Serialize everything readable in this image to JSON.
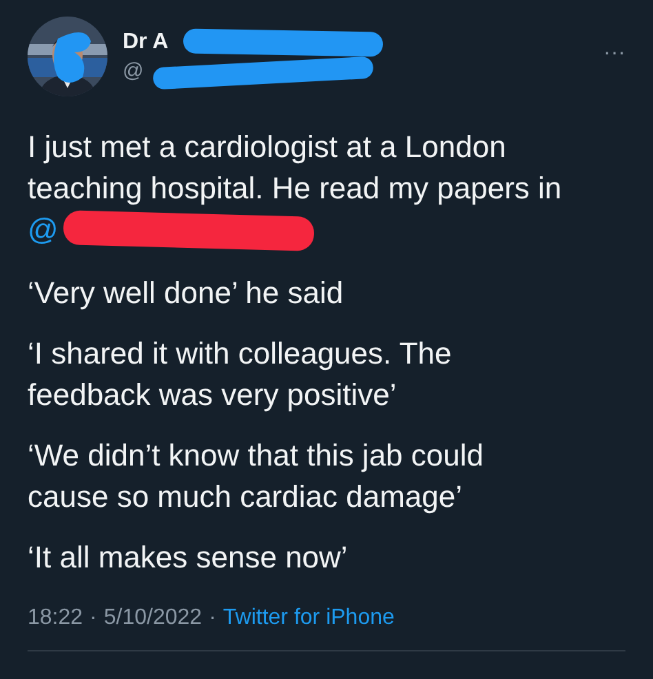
{
  "author": {
    "name": "Dr A",
    "handle": "@"
  },
  "paragraphs": [
    {
      "text": "I just met a cardiologist at a London teaching hospital. He read my papers in",
      "mention": "@"
    },
    {
      "text": "‘Very well done’ he said"
    },
    {
      "text": "‘I shared it with colleagues. The feedback was very positive’"
    },
    {
      "text": "‘We didn’t know that this jab could cause so much cardiac damage’"
    },
    {
      "text": "‘It all makes sense now’"
    }
  ],
  "more_menu": "···",
  "meta": {
    "time": "18:22",
    "separator_1": "·",
    "date": "5/10/2022",
    "separator_2": "·",
    "source": "Twitter for iPhone"
  }
}
